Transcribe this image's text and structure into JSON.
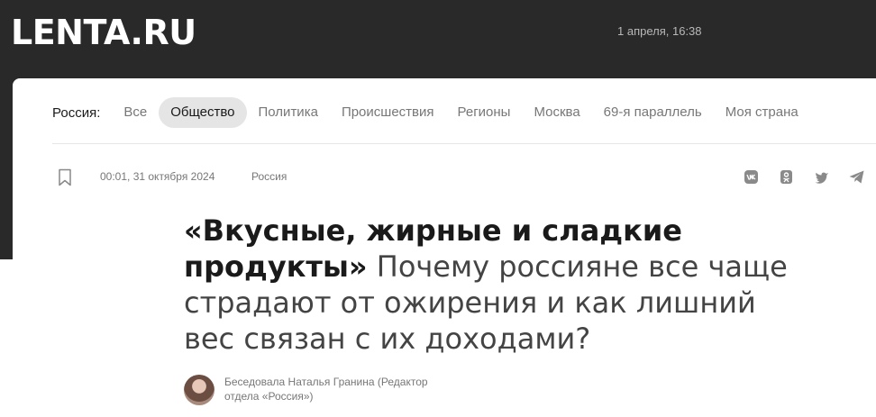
{
  "header": {
    "logo": "LENTA.RU",
    "datetime": "1 апреля, 16:38"
  },
  "rubrics": {
    "label": "Россия:",
    "items": [
      "Все",
      "Общество",
      "Политика",
      "Происшествия",
      "Регионы",
      "Москва",
      "69-я параллель",
      "Моя страна"
    ],
    "active": "Общество"
  },
  "article": {
    "date": "00:01, 31 октября 2024",
    "section": "Россия",
    "title_bold": "«Вкусные, жирные и сладкие продукты»",
    "title_rest": "Почему россияне все чаще страдают от ожирения и как лишний вес связан с их доходами?",
    "author": "Беседовала Наталья Гранина (Редактор отдела «Россия»)"
  },
  "share": {
    "icons": [
      "vk-icon",
      "odnoklassniki-icon",
      "twitter-icon",
      "telegram-icon"
    ]
  },
  "colors": {
    "header_bg": "#292929",
    "active_tab_bg": "#e5e5e5",
    "muted_text": "#777777"
  }
}
